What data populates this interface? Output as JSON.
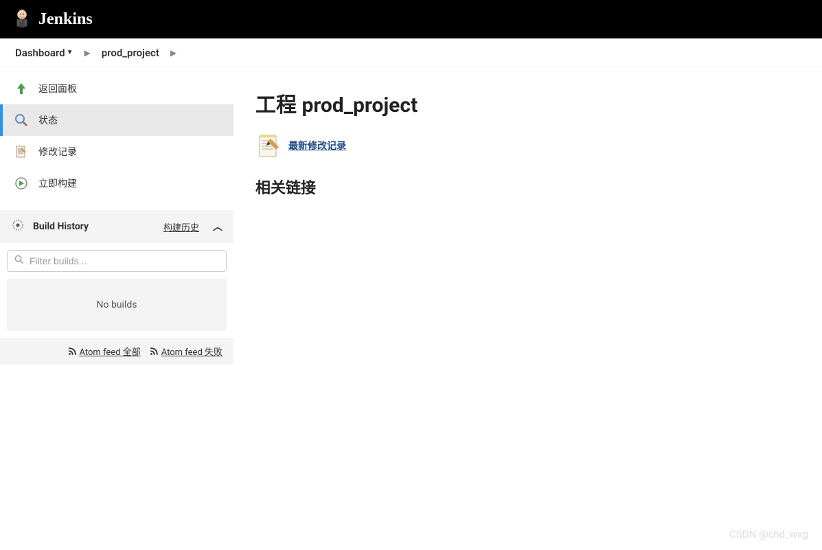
{
  "header": {
    "brand": "Jenkins"
  },
  "breadcrumb": {
    "items": [
      {
        "label": "Dashboard",
        "hasDropdown": true
      },
      {
        "label": "prod_project",
        "hasDropdown": false
      }
    ]
  },
  "sidebar": {
    "items": [
      {
        "label": "返回面板",
        "icon": "arrow-up"
      },
      {
        "label": "状态",
        "icon": "search",
        "active": true
      },
      {
        "label": "修改记录",
        "icon": "notepad"
      },
      {
        "label": "立即构建",
        "icon": "clock-play"
      }
    ],
    "buildHistory": {
      "title": "Build History",
      "subtitle": "构建历史",
      "filterPlaceholder": "Filter builds...",
      "emptyMessage": "No builds",
      "feeds": [
        {
          "label": "Atom feed 全部"
        },
        {
          "label": "Atom feed 失败"
        }
      ]
    }
  },
  "main": {
    "title": "工程 prod_project",
    "changesLink": "最新修改记录",
    "sectionTitle": "相关链接"
  },
  "watermark": "CSDN @chd_wxg"
}
